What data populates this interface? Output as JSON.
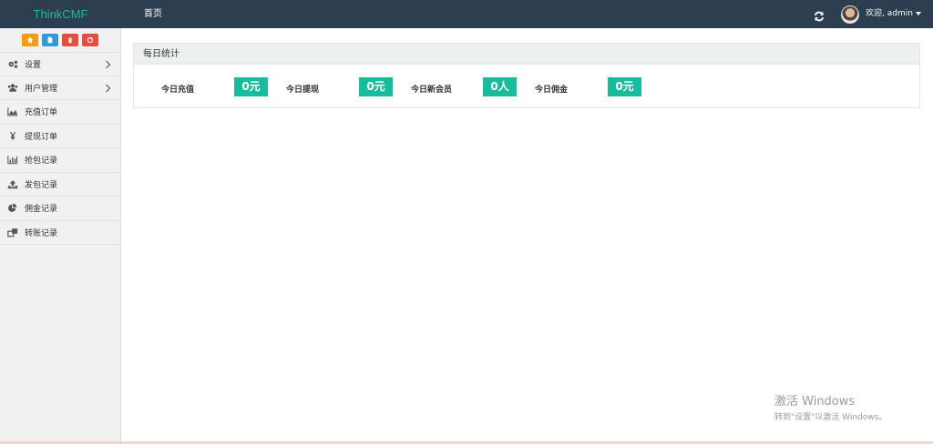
{
  "header": {
    "brand": "ThinkCMF",
    "nav_home": "首页",
    "welcome": "欢迎, admin"
  },
  "sidebar": {
    "quick_buttons": [
      {
        "icon": "home-icon",
        "color": "#f39c12"
      },
      {
        "icon": "file-icon",
        "color": "#3498db"
      },
      {
        "icon": "trash-icon",
        "color": "#e74c3c"
      },
      {
        "icon": "recycle-icon",
        "color": "#e74c3c"
      }
    ],
    "items": [
      {
        "label": "设置",
        "icon": "gears-icon"
      },
      {
        "label": "用户管理",
        "icon": "users-icon"
      },
      {
        "label": "充值订单",
        "icon": "area-chart-icon"
      },
      {
        "label": "提现订单",
        "icon": "yen-icon"
      },
      {
        "label": "抢包记录",
        "icon": "bar-chart-icon"
      },
      {
        "label": "发包记录",
        "icon": "upload-icon"
      },
      {
        "label": "佣金记录",
        "icon": "pie-chart-icon"
      },
      {
        "label": "转账记录",
        "icon": "transfer-icon"
      }
    ]
  },
  "panel": {
    "title": "每日统计",
    "stats": [
      {
        "label": "今日充值",
        "value": "0元"
      },
      {
        "label": "今日提现",
        "value": "0元"
      },
      {
        "label": "今日新会员",
        "value": "0人"
      },
      {
        "label": "今日佣金",
        "value": "0元"
      }
    ]
  },
  "watermark": {
    "line1": "激活 Windows",
    "line2": "转到\"设置\"以激活 Windows。"
  },
  "colors": {
    "topbar": "#2c3e50",
    "accent": "#18bc9c"
  }
}
